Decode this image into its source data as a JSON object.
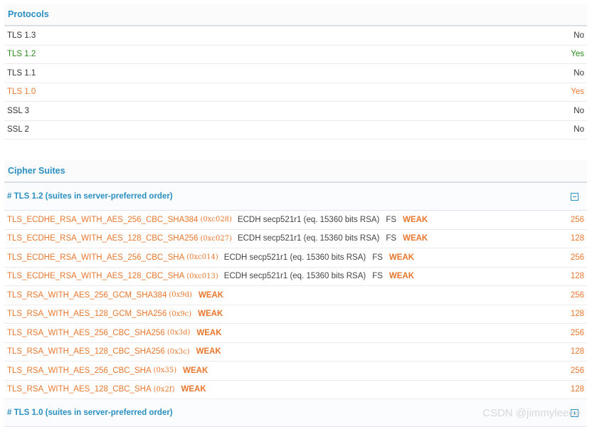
{
  "protocols": {
    "title": "Protocols",
    "rows": [
      {
        "label": "TLS 1.3",
        "value": "No",
        "color": "gray"
      },
      {
        "label": "TLS 1.2",
        "value": "Yes",
        "color": "green"
      },
      {
        "label": "TLS 1.1",
        "value": "No",
        "color": "gray"
      },
      {
        "label": "TLS 1.0",
        "value": "Yes",
        "color": "orange"
      },
      {
        "label": "SSL 3",
        "value": "No",
        "color": "gray"
      },
      {
        "label": "SSL 2",
        "value": "No",
        "color": "gray"
      }
    ]
  },
  "ciphers": {
    "title": "Cipher Suites",
    "groups": [
      {
        "header": "# TLS 1.2 (suites in server-preferred order)",
        "toggle": "collapse",
        "suites": [
          {
            "name": "TLS_ECDHE_RSA_WITH_AES_256_CBC_SHA384",
            "code": "(0xc028)",
            "kx": "ECDH secp521r1 (eq. 15360 bits RSA)",
            "fs": "FS",
            "weak": "WEAK",
            "bits": "256"
          },
          {
            "name": "TLS_ECDHE_RSA_WITH_AES_128_CBC_SHA256",
            "code": "(0xc027)",
            "kx": "ECDH secp521r1 (eq. 15360 bits RSA)",
            "fs": "FS",
            "weak": "WEAK",
            "bits": "128"
          },
          {
            "name": "TLS_ECDHE_RSA_WITH_AES_256_CBC_SHA",
            "code": "(0xc014)",
            "kx": "ECDH secp521r1 (eq. 15360 bits RSA)",
            "fs": "FS",
            "weak": "WEAK",
            "bits": "256"
          },
          {
            "name": "TLS_ECDHE_RSA_WITH_AES_128_CBC_SHA",
            "code": "(0xc013)",
            "kx": "ECDH secp521r1 (eq. 15360 bits RSA)",
            "fs": "FS",
            "weak": "WEAK",
            "bits": "128"
          },
          {
            "name": "TLS_RSA_WITH_AES_256_GCM_SHA384",
            "code": "(0x9d)",
            "kx": "",
            "fs": "",
            "weak": "WEAK",
            "bits": "256"
          },
          {
            "name": "TLS_RSA_WITH_AES_128_GCM_SHA256",
            "code": "(0x9c)",
            "kx": "",
            "fs": "",
            "weak": "WEAK",
            "bits": "128"
          },
          {
            "name": "TLS_RSA_WITH_AES_256_CBC_SHA256",
            "code": "(0x3d)",
            "kx": "",
            "fs": "",
            "weak": "WEAK",
            "bits": "256"
          },
          {
            "name": "TLS_RSA_WITH_AES_128_CBC_SHA256",
            "code": "(0x3c)",
            "kx": "",
            "fs": "",
            "weak": "WEAK",
            "bits": "128"
          },
          {
            "name": "TLS_RSA_WITH_AES_256_CBC_SHA",
            "code": "(0x35)",
            "kx": "",
            "fs": "",
            "weak": "WEAK",
            "bits": "256"
          },
          {
            "name": "TLS_RSA_WITH_AES_128_CBC_SHA",
            "code": "(0x2f)",
            "kx": "",
            "fs": "",
            "weak": "WEAK",
            "bits": "128"
          }
        ]
      },
      {
        "header": "# TLS 1.0 (suites in server-preferred order)",
        "toggle": "expand",
        "suites": []
      }
    ]
  },
  "watermark": "CSDN @jimmyleeee",
  "colors": {
    "accent": "#2a8fc1",
    "yes": "#2a8a1b",
    "warn": "#e8772d"
  }
}
